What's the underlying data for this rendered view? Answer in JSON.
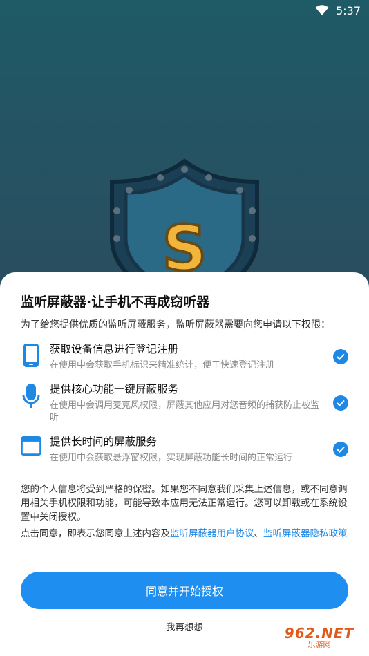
{
  "status_bar": {
    "time": "5:37"
  },
  "dialog": {
    "title": "监听屏蔽器·让手机不再成窃听器",
    "intro": "为了给您提供优质的监听屏蔽服务，监听屏蔽器需要向您申请以下权限：",
    "permissions": [
      {
        "icon": "phone-icon",
        "title": "获取设备信息进行登记注册",
        "desc": "在使用中会获取手机标识来精准统计，便于快速登记注册"
      },
      {
        "icon": "microphone-icon",
        "title": "提供核心功能一键屏蔽服务",
        "desc": "在使用中会调用麦克风权限，屏蔽其他应用对您音频的捕获防止被监听"
      },
      {
        "icon": "window-icon",
        "title": "提供长时间的屏蔽服务",
        "desc": "在使用中会获取悬浮窗权限，实现屏蔽功能长时间的正常运行"
      }
    ],
    "notice": "您的个人信息将受到严格的保密。如果您不同意我们采集上述信息，或不同意调用相关手机权限和功能，可能导致本应用无法正常运行。您可以卸载或在系统设置中关闭授权。",
    "agree_prefix": "点击同意，即表示您同意上述内容及",
    "user_agreement": "监听屏蔽器用户协议",
    "separator": "、",
    "privacy_policy": "监听屏蔽器隐私政策",
    "agree_button": "同意并开始授权",
    "decline_button": "我再想想"
  },
  "watermark": {
    "top": "962.NET",
    "bottom": "乐游网"
  },
  "colors": {
    "accent": "#1e88e5",
    "button": "#1e8ef0",
    "background_top": "#1f5a67"
  }
}
